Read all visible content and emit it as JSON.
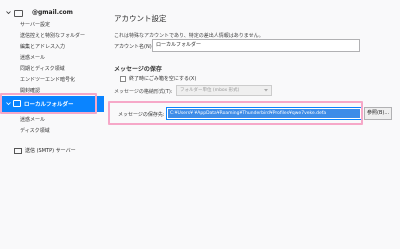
{
  "sidebar": {
    "account": {
      "label": "@gmail.com"
    },
    "items": [
      {
        "label": "サーバー設定"
      },
      {
        "label": "送信控えと特別なフォルダー"
      },
      {
        "label": "編集とアドレス入力"
      },
      {
        "label": "迷惑メール"
      },
      {
        "label": "同期とディスク領域"
      },
      {
        "label": "エンドツーエンド暗号化"
      },
      {
        "label": "開封確認"
      }
    ],
    "local_folders": {
      "label": "ローカルフォルダー",
      "items": [
        {
          "label": "迷惑メール"
        },
        {
          "label": "ディスク領域"
        }
      ]
    },
    "smtp": {
      "label": "送信 (SMTP) サーバー"
    }
  },
  "main": {
    "title": "アカウント設定",
    "description": "これは特殊なアカウントであり、特定の差出人情報はありません。",
    "account_name": {
      "label": "アカウント名(N):",
      "value": "ローカルフォルダー"
    },
    "message_storage": {
      "title": "メッセージの保存",
      "empty_trash_label": "終了時にごみ箱を空にする(X)",
      "format_label": "メッセージの格納形式(T):",
      "format_value": "フォルダー単位 (mbox 形式)",
      "store_label": "メッセージの保存先:",
      "store_value": "C:¥Users¥        ¥AppData¥Roaming¥Thunderbird¥Profiles¥qwe7veke.defa",
      "browse_label": "参照(B)..."
    }
  },
  "colors": {
    "accent": "#0a84ff",
    "highlight": "#f6a8c8",
    "selection": "#3d8ce8"
  }
}
